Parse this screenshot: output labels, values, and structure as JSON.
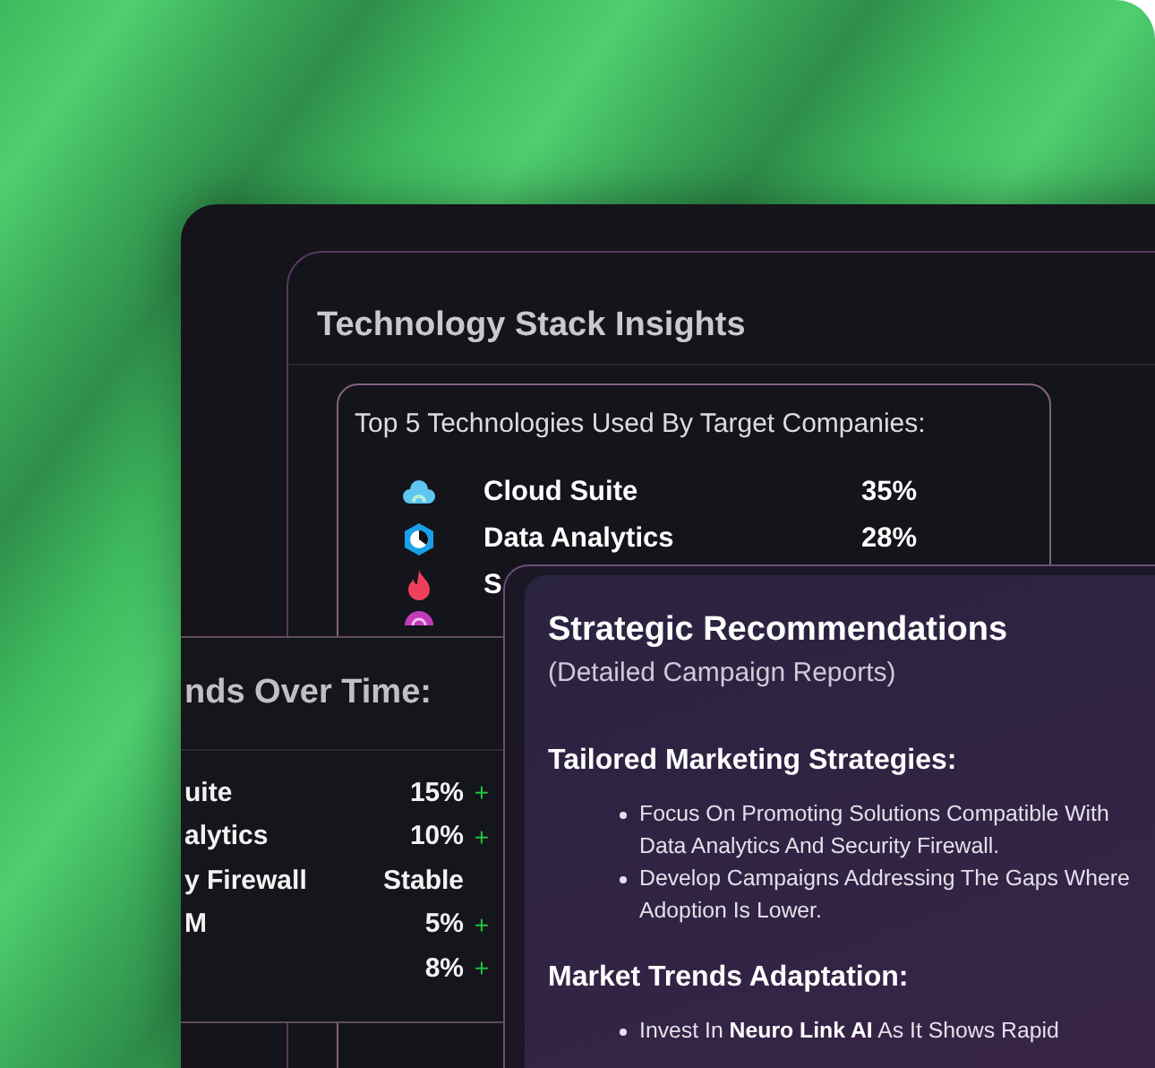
{
  "tech_stack": {
    "title": "Technology Stack Insights",
    "list_title": "Top 5 Technologies Used By Target Companies:",
    "rows": [
      {
        "name": "Cloud Suite",
        "share": "35%"
      },
      {
        "name": "Data Analytics",
        "share": "28%"
      },
      {
        "name": "S"
      },
      {}
    ]
  },
  "trends": {
    "title": "nds Over Time:",
    "rows": [
      {
        "name": "uite",
        "value": "15%",
        "change": "+"
      },
      {
        "name": "alytics",
        "value": "10%",
        "change": "+"
      },
      {
        "name": "y Firewall",
        "value": "Stable"
      },
      {
        "name": "M",
        "value": "5%",
        "change": "+"
      },
      {
        "value": "8%",
        "change": "+"
      }
    ]
  },
  "recommendations": {
    "title": "Strategic Recommendations",
    "subtitle": "(Detailed Campaign Reports)",
    "sections": [
      {
        "heading": "Tailored Marketing Strategies:",
        "bullets": [
          "Focus On Promoting Solutions Compatible With Data Analytics And Security Firewall.",
          "Develop Campaigns Addressing The Gaps Where Adoption Is Lower."
        ]
      },
      {
        "heading": "Market Trends Adaptation:",
        "bullets": [
          "Invest In **Neuro Link AI** As It Shows Rapid"
        ]
      }
    ]
  }
}
